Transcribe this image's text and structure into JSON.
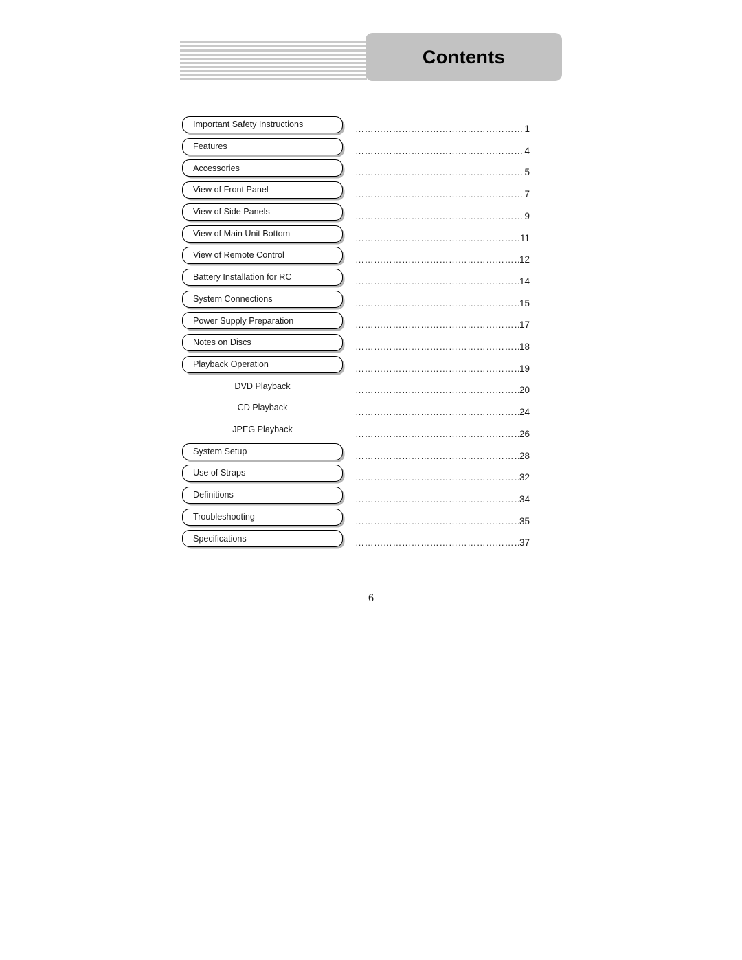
{
  "document": {
    "header": {
      "title": "Contents",
      "title_box_color": "#c2c2c2",
      "stripe_color": "#c9c9c9",
      "rule_color": "#2a2a2a"
    },
    "folio": "6",
    "leader_char": "…………………………………………………",
    "entries": [
      {
        "label": "Important Safety Instructions",
        "page": "1",
        "level": 1
      },
      {
        "label": "Features",
        "page": "4",
        "level": 1
      },
      {
        "label": "Accessories",
        "page": "5",
        "level": 1
      },
      {
        "label": "View of Front Panel",
        "page": "7",
        "level": 1
      },
      {
        "label": "View of Side Panels",
        "page": "9",
        "level": 1
      },
      {
        "label": "View of Main Unit Bottom",
        "page": "11",
        "level": 1
      },
      {
        "label": "View of Remote Control",
        "page": "12",
        "level": 1
      },
      {
        "label": "Battery Installation for RC",
        "page": "14",
        "level": 1
      },
      {
        "label": "System Connections",
        "page": "15",
        "level": 1
      },
      {
        "label": "Power Supply Preparation",
        "page": "17",
        "level": 1
      },
      {
        "label": "Notes on Discs",
        "page": "18",
        "level": 1
      },
      {
        "label": "Playback Operation",
        "page": "19",
        "level": 1
      },
      {
        "label": "DVD Playback",
        "page": "20",
        "level": 2
      },
      {
        "label": "CD Playback",
        "page": "24",
        "level": 2
      },
      {
        "label": "JPEG Playback",
        "page": "26",
        "level": 2
      },
      {
        "label": "System Setup",
        "page": "28",
        "level": 1
      },
      {
        "label": "Use of Straps",
        "page": "32",
        "level": 1
      },
      {
        "label": "Definitions",
        "page": "34",
        "level": 1
      },
      {
        "label": "Troubleshooting",
        "page": "35",
        "level": 1
      },
      {
        "label": "Specifications",
        "page": "37",
        "level": 1
      }
    ]
  }
}
